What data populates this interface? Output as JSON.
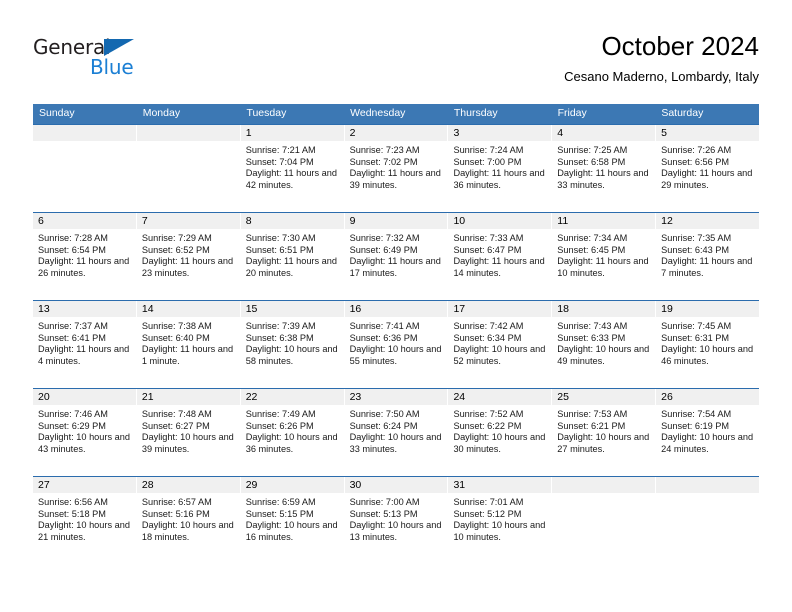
{
  "brand": {
    "name_part1": "General",
    "name_part2": "Blue",
    "accent_color": "#1368b0",
    "blue_text_color": "#1b7fd4"
  },
  "header": {
    "title": "October 2024",
    "subtitle": "Cesano Maderno, Lombardy, Italy"
  },
  "theme": {
    "header_blue": "#3c78b4",
    "row_divider_blue": "#2b6cad",
    "day_band_gray": "#f0f0f0"
  },
  "weekdays": [
    "Sunday",
    "Monday",
    "Tuesday",
    "Wednesday",
    "Thursday",
    "Friday",
    "Saturday"
  ],
  "weeks": [
    [
      {
        "day": "",
        "sunrise": "",
        "sunset": "",
        "daylight": "",
        "empty": true
      },
      {
        "day": "",
        "sunrise": "",
        "sunset": "",
        "daylight": "",
        "empty": true
      },
      {
        "day": "1",
        "sunrise": "Sunrise: 7:21 AM",
        "sunset": "Sunset: 7:04 PM",
        "daylight": "Daylight: 11 hours and 42 minutes."
      },
      {
        "day": "2",
        "sunrise": "Sunrise: 7:23 AM",
        "sunset": "Sunset: 7:02 PM",
        "daylight": "Daylight: 11 hours and 39 minutes."
      },
      {
        "day": "3",
        "sunrise": "Sunrise: 7:24 AM",
        "sunset": "Sunset: 7:00 PM",
        "daylight": "Daylight: 11 hours and 36 minutes."
      },
      {
        "day": "4",
        "sunrise": "Sunrise: 7:25 AM",
        "sunset": "Sunset: 6:58 PM",
        "daylight": "Daylight: 11 hours and 33 minutes."
      },
      {
        "day": "5",
        "sunrise": "Sunrise: 7:26 AM",
        "sunset": "Sunset: 6:56 PM",
        "daylight": "Daylight: 11 hours and 29 minutes."
      }
    ],
    [
      {
        "day": "6",
        "sunrise": "Sunrise: 7:28 AM",
        "sunset": "Sunset: 6:54 PM",
        "daylight": "Daylight: 11 hours and 26 minutes."
      },
      {
        "day": "7",
        "sunrise": "Sunrise: 7:29 AM",
        "sunset": "Sunset: 6:52 PM",
        "daylight": "Daylight: 11 hours and 23 minutes."
      },
      {
        "day": "8",
        "sunrise": "Sunrise: 7:30 AM",
        "sunset": "Sunset: 6:51 PM",
        "daylight": "Daylight: 11 hours and 20 minutes."
      },
      {
        "day": "9",
        "sunrise": "Sunrise: 7:32 AM",
        "sunset": "Sunset: 6:49 PM",
        "daylight": "Daylight: 11 hours and 17 minutes."
      },
      {
        "day": "10",
        "sunrise": "Sunrise: 7:33 AM",
        "sunset": "Sunset: 6:47 PM",
        "daylight": "Daylight: 11 hours and 14 minutes."
      },
      {
        "day": "11",
        "sunrise": "Sunrise: 7:34 AM",
        "sunset": "Sunset: 6:45 PM",
        "daylight": "Daylight: 11 hours and 10 minutes."
      },
      {
        "day": "12",
        "sunrise": "Sunrise: 7:35 AM",
        "sunset": "Sunset: 6:43 PM",
        "daylight": "Daylight: 11 hours and 7 minutes."
      }
    ],
    [
      {
        "day": "13",
        "sunrise": "Sunrise: 7:37 AM",
        "sunset": "Sunset: 6:41 PM",
        "daylight": "Daylight: 11 hours and 4 minutes."
      },
      {
        "day": "14",
        "sunrise": "Sunrise: 7:38 AM",
        "sunset": "Sunset: 6:40 PM",
        "daylight": "Daylight: 11 hours and 1 minute."
      },
      {
        "day": "15",
        "sunrise": "Sunrise: 7:39 AM",
        "sunset": "Sunset: 6:38 PM",
        "daylight": "Daylight: 10 hours and 58 minutes."
      },
      {
        "day": "16",
        "sunrise": "Sunrise: 7:41 AM",
        "sunset": "Sunset: 6:36 PM",
        "daylight": "Daylight: 10 hours and 55 minutes."
      },
      {
        "day": "17",
        "sunrise": "Sunrise: 7:42 AM",
        "sunset": "Sunset: 6:34 PM",
        "daylight": "Daylight: 10 hours and 52 minutes."
      },
      {
        "day": "18",
        "sunrise": "Sunrise: 7:43 AM",
        "sunset": "Sunset: 6:33 PM",
        "daylight": "Daylight: 10 hours and 49 minutes."
      },
      {
        "day": "19",
        "sunrise": "Sunrise: 7:45 AM",
        "sunset": "Sunset: 6:31 PM",
        "daylight": "Daylight: 10 hours and 46 minutes."
      }
    ],
    [
      {
        "day": "20",
        "sunrise": "Sunrise: 7:46 AM",
        "sunset": "Sunset: 6:29 PM",
        "daylight": "Daylight: 10 hours and 43 minutes."
      },
      {
        "day": "21",
        "sunrise": "Sunrise: 7:48 AM",
        "sunset": "Sunset: 6:27 PM",
        "daylight": "Daylight: 10 hours and 39 minutes."
      },
      {
        "day": "22",
        "sunrise": "Sunrise: 7:49 AM",
        "sunset": "Sunset: 6:26 PM",
        "daylight": "Daylight: 10 hours and 36 minutes."
      },
      {
        "day": "23",
        "sunrise": "Sunrise: 7:50 AM",
        "sunset": "Sunset: 6:24 PM",
        "daylight": "Daylight: 10 hours and 33 minutes."
      },
      {
        "day": "24",
        "sunrise": "Sunrise: 7:52 AM",
        "sunset": "Sunset: 6:22 PM",
        "daylight": "Daylight: 10 hours and 30 minutes."
      },
      {
        "day": "25",
        "sunrise": "Sunrise: 7:53 AM",
        "sunset": "Sunset: 6:21 PM",
        "daylight": "Daylight: 10 hours and 27 minutes."
      },
      {
        "day": "26",
        "sunrise": "Sunrise: 7:54 AM",
        "sunset": "Sunset: 6:19 PM",
        "daylight": "Daylight: 10 hours and 24 minutes."
      }
    ],
    [
      {
        "day": "27",
        "sunrise": "Sunrise: 6:56 AM",
        "sunset": "Sunset: 5:18 PM",
        "daylight": "Daylight: 10 hours and 21 minutes."
      },
      {
        "day": "28",
        "sunrise": "Sunrise: 6:57 AM",
        "sunset": "Sunset: 5:16 PM",
        "daylight": "Daylight: 10 hours and 18 minutes."
      },
      {
        "day": "29",
        "sunrise": "Sunrise: 6:59 AM",
        "sunset": "Sunset: 5:15 PM",
        "daylight": "Daylight: 10 hours and 16 minutes."
      },
      {
        "day": "30",
        "sunrise": "Sunrise: 7:00 AM",
        "sunset": "Sunset: 5:13 PM",
        "daylight": "Daylight: 10 hours and 13 minutes."
      },
      {
        "day": "31",
        "sunrise": "Sunrise: 7:01 AM",
        "sunset": "Sunset: 5:12 PM",
        "daylight": "Daylight: 10 hours and 10 minutes."
      },
      {
        "day": "",
        "sunrise": "",
        "sunset": "",
        "daylight": "",
        "empty": true
      },
      {
        "day": "",
        "sunrise": "",
        "sunset": "",
        "daylight": "",
        "empty": true
      }
    ]
  ]
}
